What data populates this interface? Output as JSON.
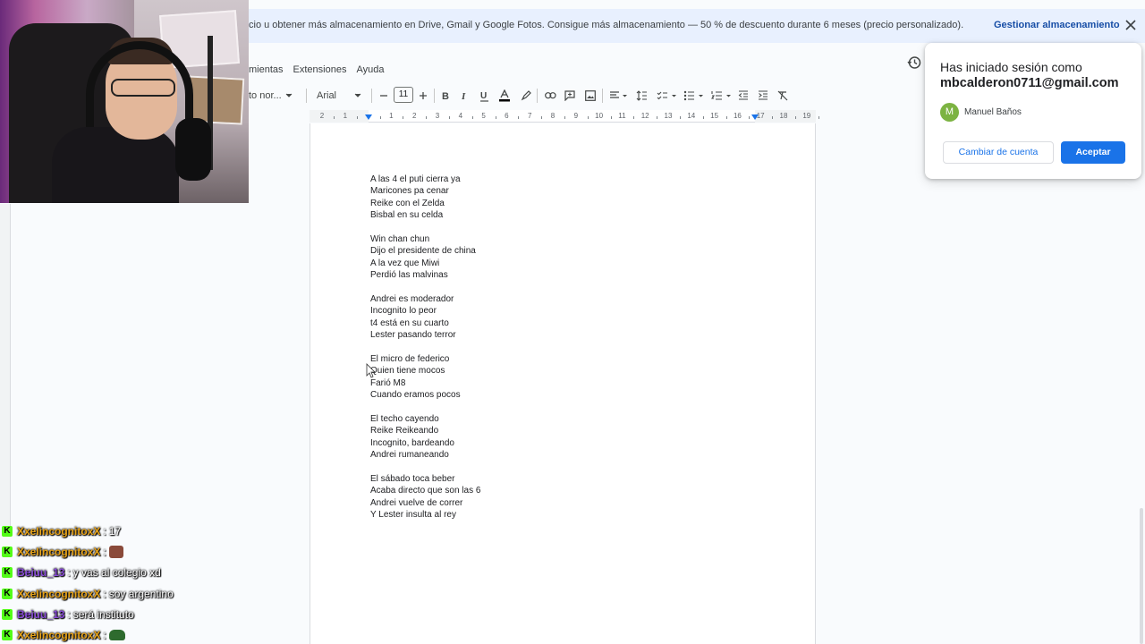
{
  "banner": {
    "text": "cio u obtener más almacenamiento en Drive, Gmail y Google Fotos. Consigue más almacenamiento — 50 % de descuento durante 6 meses (precio personalizado).",
    "link": "Gestionar almacenamiento"
  },
  "menubar": [
    "mientas",
    "Extensiones",
    "Ayuda"
  ],
  "toolbar": {
    "style": "to nor...",
    "font": "Arial",
    "font_size": "11"
  },
  "ruler": {
    "numbers": [
      "2",
      "1",
      "",
      "1",
      "2",
      "3",
      "4",
      "5",
      "6",
      "7",
      "8",
      "9",
      "10",
      "11",
      "12",
      "13",
      "14",
      "15",
      "16",
      "17",
      "18",
      "19"
    ]
  },
  "document": {
    "lines": [
      "A las 4 el puti cierra ya",
      "Maricones pa cenar",
      "Reike con el Zelda",
      "Bisbal en su celda",
      "",
      "Win chan chun",
      "Dijo el presidente de china",
      "A la vez que Miwi",
      "Perdió las malvinas",
      "",
      "Andrei es moderador",
      "Incognito lo peor",
      "t4 está en su cuarto",
      "Lester pasando terror",
      "",
      "El micro de federico",
      "Quien tiene mocos",
      "Farió M8",
      "Cuando eramos pocos",
      "",
      "El techo cayendo",
      "Reike Reikeando",
      "Incognito, bardeando",
      "Andrei rumaneando",
      "",
      "El sábado toca beber",
      "Acaba directo que son las 6",
      "Andrei vuelve de correr",
      "Y Lester insulta al rey"
    ]
  },
  "account_popup": {
    "title_line1": "Has iniciado sesión como",
    "email": "mbcalderon0711@gmail.com",
    "avatar_letter": "M",
    "name": "Manuel Baños",
    "switch_label": "Cambiar de cuenta",
    "accept_label": "Aceptar"
  },
  "chat": [
    {
      "user": "XxeIincognitoxX",
      "user_color": "#e8a317",
      "sep": ":",
      "msg": "17",
      "emote": ""
    },
    {
      "user": "XxeIincognitoxX",
      "user_color": "#e8a317",
      "sep": ":",
      "msg": "",
      "emote": "face"
    },
    {
      "user": "Beiuu_13",
      "user_color": "#8a4cd9",
      "sep": ":",
      "msg": "y vas al colegio xd",
      "emote": ""
    },
    {
      "user": "XxeIincognitoxX",
      "user_color": "#e8a317",
      "sep": ":",
      "msg": "soy argentino",
      "emote": ""
    },
    {
      "user": "Beiuu_13",
      "user_color": "#8a4cd9",
      "sep": ":",
      "msg": "será instituto",
      "emote": ""
    },
    {
      "user": "XxeIincognitoxX",
      "user_color": "#e8a317",
      "sep": ":",
      "msg": "",
      "emote": "tank"
    }
  ],
  "colors": {
    "accent": "#1a73e8",
    "banner_bg": "#e8f0fe",
    "kick_green": "#53fc18"
  }
}
